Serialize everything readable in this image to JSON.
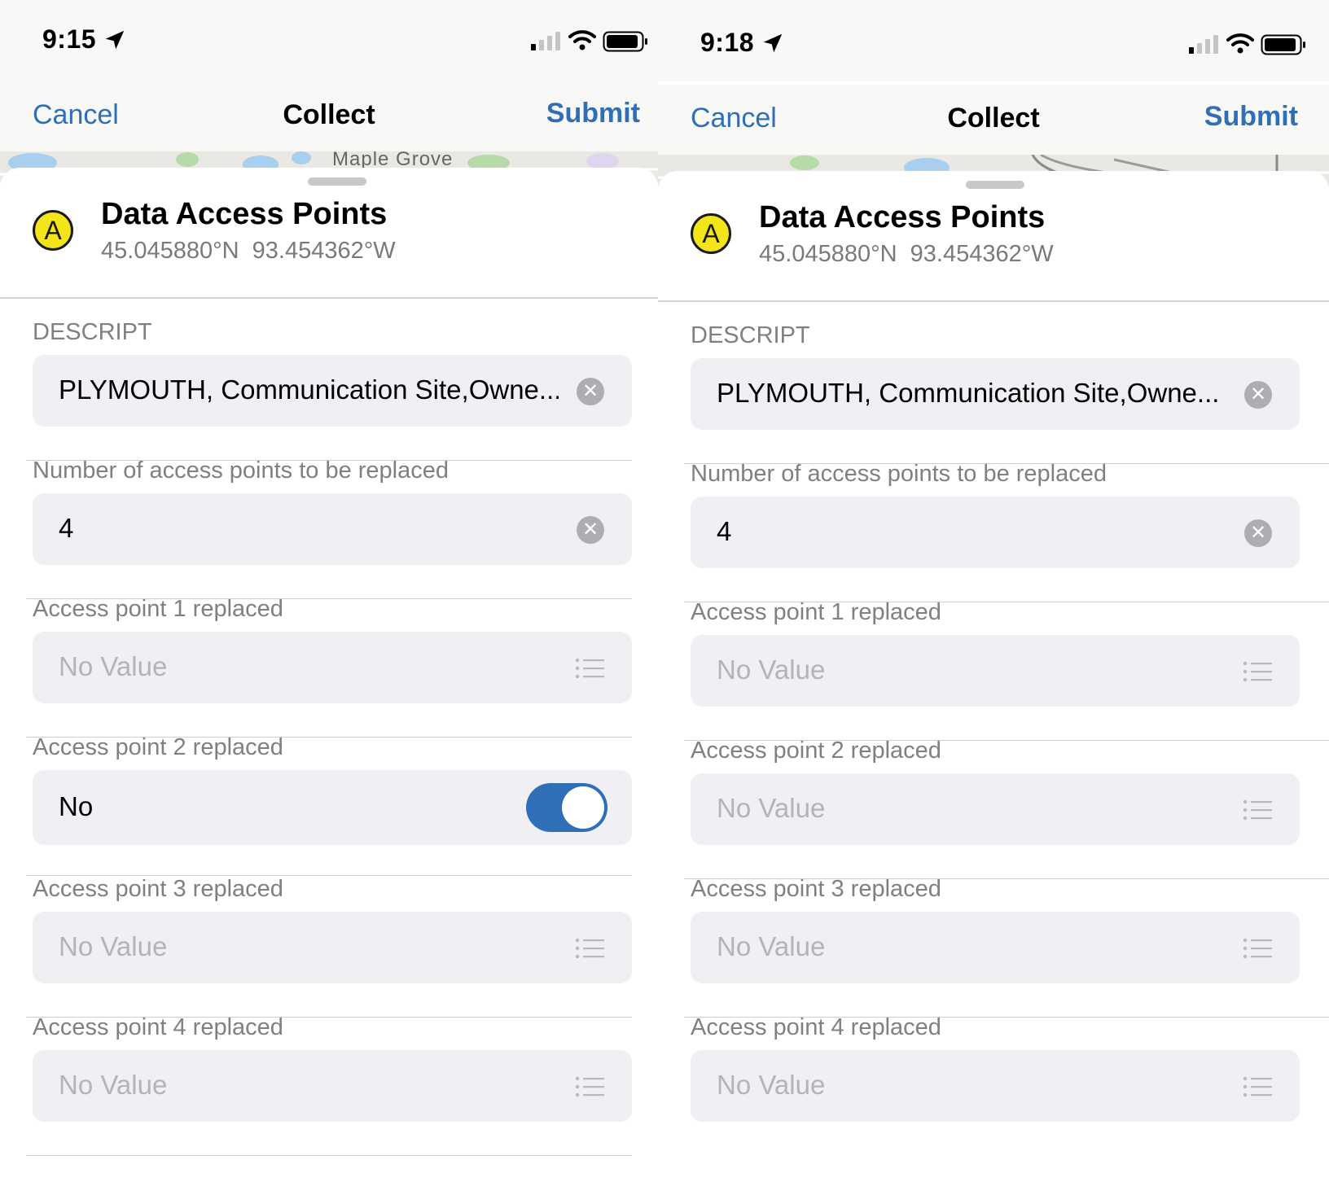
{
  "screens": [
    {
      "status": {
        "time": "9:15"
      },
      "nav": {
        "cancel": "Cancel",
        "title": "Collect",
        "submit": "Submit"
      },
      "map": {
        "label": "Maple Grove"
      },
      "header": {
        "title": "Data Access Points",
        "lat": "45.045880°N",
        "lon": "93.454362°W"
      },
      "fields": [
        {
          "label": "DESCRIPT",
          "value": "PLYMOUTH, Communication Site,Owne...",
          "control": "clear"
        },
        {
          "label": "Number of access points to be replaced",
          "value": "4",
          "control": "clear"
        },
        {
          "label": "Access point 1 replaced",
          "value": "No Value",
          "control": "list"
        },
        {
          "label": "Access point 2 replaced",
          "value": "No",
          "control": "toggle"
        },
        {
          "label": "Access point 3 replaced",
          "value": "No Value",
          "control": "list"
        },
        {
          "label": "Access point 4 replaced",
          "value": "No Value",
          "control": "list"
        }
      ]
    },
    {
      "status": {
        "time": "9:18"
      },
      "nav": {
        "cancel": "Cancel",
        "title": "Collect",
        "submit": "Submit"
      },
      "header": {
        "title": "Data Access Points",
        "lat": "45.045880°N",
        "lon": "93.454362°W"
      },
      "fields": [
        {
          "label": "DESCRIPT",
          "value": "PLYMOUTH, Communication Site,Owne...",
          "control": "clear"
        },
        {
          "label": "Number of access points to be replaced",
          "value": "4",
          "control": "clear"
        },
        {
          "label": "Access point 1 replaced",
          "value": "No Value",
          "control": "list"
        },
        {
          "label": "Access point 2 replaced",
          "value": "No Value",
          "control": "list"
        },
        {
          "label": "Access point 3 replaced",
          "value": "No Value",
          "control": "list"
        },
        {
          "label": "Access point 4 replaced",
          "value": "No Value",
          "control": "list"
        }
      ]
    }
  ],
  "colors": {
    "accent": "#2f6fb8",
    "field_bg": "#f0f0f4",
    "icon_yellow": "#f3e519"
  },
  "icons": {
    "location": "location-arrow-icon",
    "signal": "cellular-signal-icon",
    "wifi": "wifi-icon",
    "battery": "battery-icon",
    "clear": "clear-circle-icon",
    "list": "list-icon",
    "layer": "letter-a-layer-icon"
  }
}
